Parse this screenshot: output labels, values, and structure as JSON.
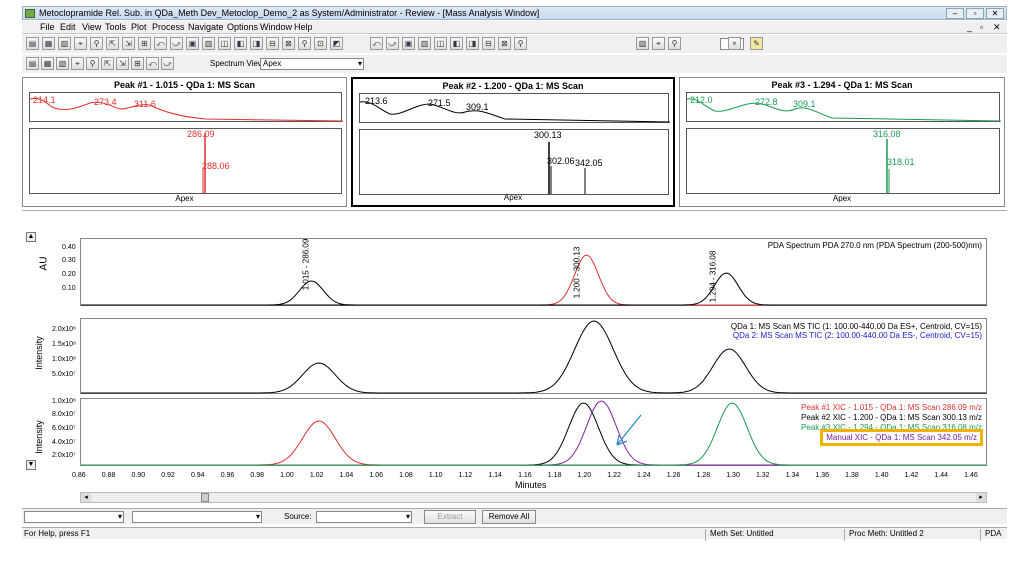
{
  "window": {
    "title": "Metoclopramide Rel. Sub. in QDa_Meth Dev_Metoclop_Demo_2 as System/Administrator - Review - [Mass Analysis Window]"
  },
  "menu": [
    "File",
    "Edit",
    "View",
    "Tools",
    "Plot",
    "Process",
    "Navigate",
    "Options",
    "Window",
    "Help"
  ],
  "spectrum_view": {
    "label": "Spectrum View",
    "value": "Apex"
  },
  "peaks": [
    {
      "title": "Peak #1 - 1.015 - QDa 1: MS Scan",
      "color": "#e03030",
      "uv_labels": [
        "214.1",
        "273.4",
        "311.6"
      ],
      "ms_labels": [
        "286.09",
        "288.06"
      ],
      "footer": "Apex"
    },
    {
      "title": "Peak #2 - 1.200 - QDa 1: MS Scan",
      "color": "#000000",
      "uv_labels": [
        "213.6",
        "271.5",
        "309.1"
      ],
      "ms_labels": [
        "300.13",
        "302.06",
        "342.05"
      ],
      "footer": "Apex"
    },
    {
      "title": "Peak #3 - 1.294 - QDa 1: MS Scan",
      "color": "#1a9a50",
      "uv_labels": [
        "212.0",
        "272.8",
        "309.1"
      ],
      "ms_labels": [
        "316.08",
        "318.01"
      ],
      "footer": "Apex"
    }
  ],
  "plots": {
    "pda": {
      "ylabel": "AU",
      "legend": "PDA Spectrum PDA 270.0 nm (PDA Spectrum (200-500)nm)",
      "ticks": [
        "0.40",
        "0.30",
        "0.20",
        "0.10"
      ],
      "peak_labels": [
        "1.015 - 286.09",
        "1.200 - 300.13",
        "1.294 - 316.08"
      ]
    },
    "tic": {
      "ylabel": "Intensity",
      "legend1": "QDa 1: MS Scan MS TIC (1: 100.00-440.00 Da ES+, Centroid, CV=15)",
      "legend2": "QDa 2: MS Scan MS TIC (2: 100.00-440.00 Da ES-, Centroid, CV=15)",
      "ticks": [
        "2.0x10⁸",
        "1.5x10⁸",
        "1.0x10⁸",
        "5.0x10⁷"
      ]
    },
    "xic": {
      "ylabel": "Intensity",
      "ticks": [
        "1.0x10⁸",
        "8.0x10⁷",
        "6.0x10⁷",
        "4.0x10⁷",
        "2.0x10⁷"
      ],
      "legend": [
        "Peak #1 XIC - 1.015 - QDa 1: MS Scan 286.09 m/z",
        "Peak #2 XIC - 1.200 - QDa 1: MS Scan 300.13 m/z",
        "Peak #3 XIC - 1.294 - QDa 1: MS Scan 316.08 m/z",
        "Manual XIC - QDa 1: MS Scan 342.05 m/z"
      ],
      "highlight_color": "#f0b400"
    },
    "xaxis": {
      "label": "Minutes",
      "ticks": [
        "0.86",
        "0.88",
        "0.90",
        "0.92",
        "0.94",
        "0.96",
        "0.98",
        "1.00",
        "1.02",
        "1.04",
        "1.06",
        "1.08",
        "1.10",
        "1.12",
        "1.14",
        "1.16",
        "1.18",
        "1.20",
        "1.22",
        "1.24",
        "1.26",
        "1.28",
        "1.30",
        "1.32",
        "1.34",
        "1.36",
        "1.38",
        "1.40",
        "1.42",
        "1.44",
        "1.46"
      ]
    }
  },
  "bottom": {
    "source_label": "Source:",
    "extract": "Extract",
    "remove_all": "Remove All"
  },
  "status": {
    "help": "For Help, press F1",
    "meth_set": "Meth Set: Untitled",
    "proc_meth": "Proc Meth: Untitled 2",
    "mode": "PDA"
  }
}
